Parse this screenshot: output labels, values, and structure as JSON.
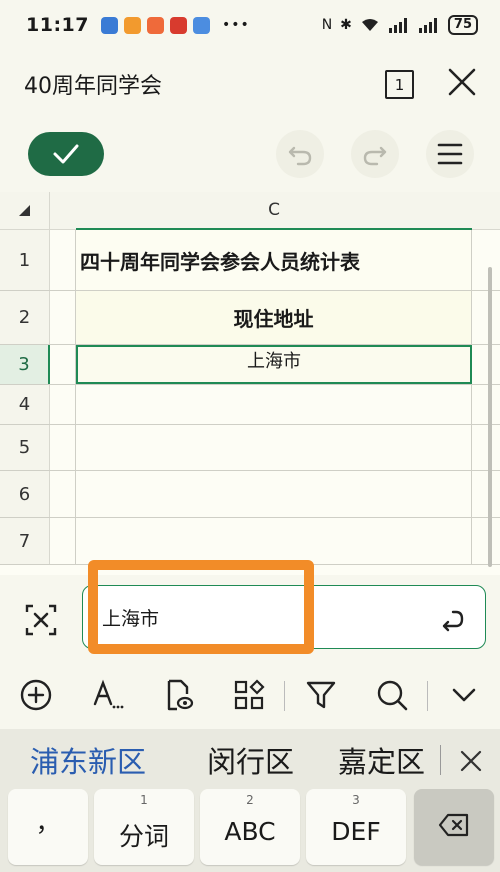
{
  "status": {
    "time": "11:17",
    "battery": "75",
    "app_colors": [
      "#3a7bd5",
      "#f29a2e",
      "#ef6a3a",
      "#d83b2e",
      "#4c8de0"
    ]
  },
  "header": {
    "title": "40周年同学会",
    "sheet_count": "1"
  },
  "grid": {
    "column": "C",
    "rows": [
      {
        "num": "1",
        "value": "四十周年同学会参会人员统计表"
      },
      {
        "num": "2",
        "value": "现住地址"
      },
      {
        "num": "3",
        "value": "上海市"
      },
      {
        "num": "4",
        "value": ""
      },
      {
        "num": "5",
        "value": ""
      },
      {
        "num": "6",
        "value": ""
      },
      {
        "num": "7",
        "value": ""
      }
    ]
  },
  "formula_bar": {
    "value": "上海市"
  },
  "tools": [
    "plus-circle-icon",
    "text-format-icon",
    "file-view-icon",
    "apps-icon",
    "filter-icon",
    "search-icon",
    "chevron-down-icon"
  ],
  "ime": {
    "candidates": [
      "浦东新区",
      "闵行区",
      "嘉定区"
    ],
    "keys": [
      {
        "num": "",
        "label": "，"
      },
      {
        "num": "1",
        "label": "分词"
      },
      {
        "num": "2",
        "label": "ABC"
      },
      {
        "num": "3",
        "label": "DEF"
      }
    ]
  },
  "colors": {
    "accent": "#1f6b45",
    "highlight": "#f28c28",
    "candidate": "#2a5db0"
  }
}
